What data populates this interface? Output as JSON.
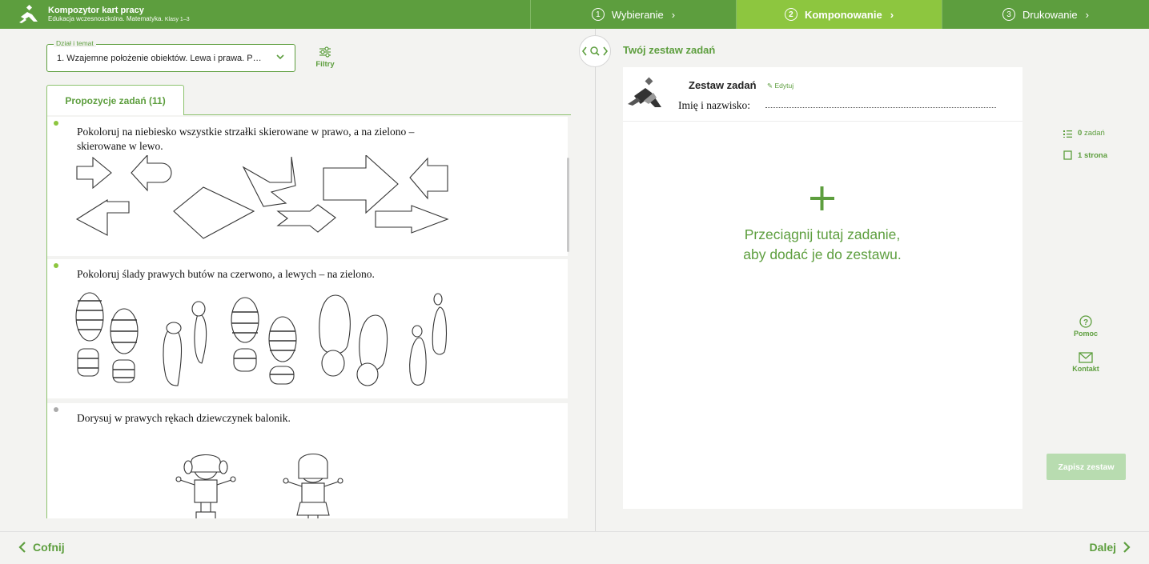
{
  "app": {
    "title": "Kompozytor kart pracy",
    "subtitle": "Edukacja wczesnoszkolna. Matematyka.",
    "subtitle_classes": "Klasy 1–3"
  },
  "steps": [
    {
      "num": "1",
      "label": "Wybieranie"
    },
    {
      "num": "2",
      "label": "Komponowanie"
    },
    {
      "num": "3",
      "label": "Drukowanie"
    }
  ],
  "topic_select": {
    "legend": "Dział i temat",
    "value": "1. Wzajemne położenie obiektów. Lewa i prawa. Pi..."
  },
  "filters_label": "Filtry",
  "tab_label": "Propozycje zadań (11)",
  "tasks": [
    {
      "text": "Pokoloruj na niebiesko wszystkie strzałki skierowane w prawo, a na zielono – skierowane w lewo."
    },
    {
      "text": "Pokoloruj ślady prawych butów na czerwono, a lewych – na zielono."
    },
    {
      "text": "Dorysuj w prawych rękach dziewczynek balonik."
    }
  ],
  "set_panel": {
    "title": "Twój zestaw zadań",
    "sheet_name": "Zestaw zadań",
    "edit_label": "Edytuj",
    "name_label": "Imię i nazwisko:",
    "drop_line1": "Przeciągnij tutaj zadanie,",
    "drop_line2": "aby dodać je do zestawu."
  },
  "stats": {
    "tasks_count": "0",
    "tasks_label": "zadań",
    "pages_count": "1",
    "pages_label": "strona"
  },
  "help_label": "Pomoc",
  "contact_label": "Kontakt",
  "save_label": "Zapisz zestaw",
  "nav": {
    "back": "Cofnij",
    "next": "Dalej"
  },
  "colors": {
    "brand": "#5d9e3e",
    "active_step": "#8dc63f",
    "save_disabled": "#b8dcb0"
  }
}
